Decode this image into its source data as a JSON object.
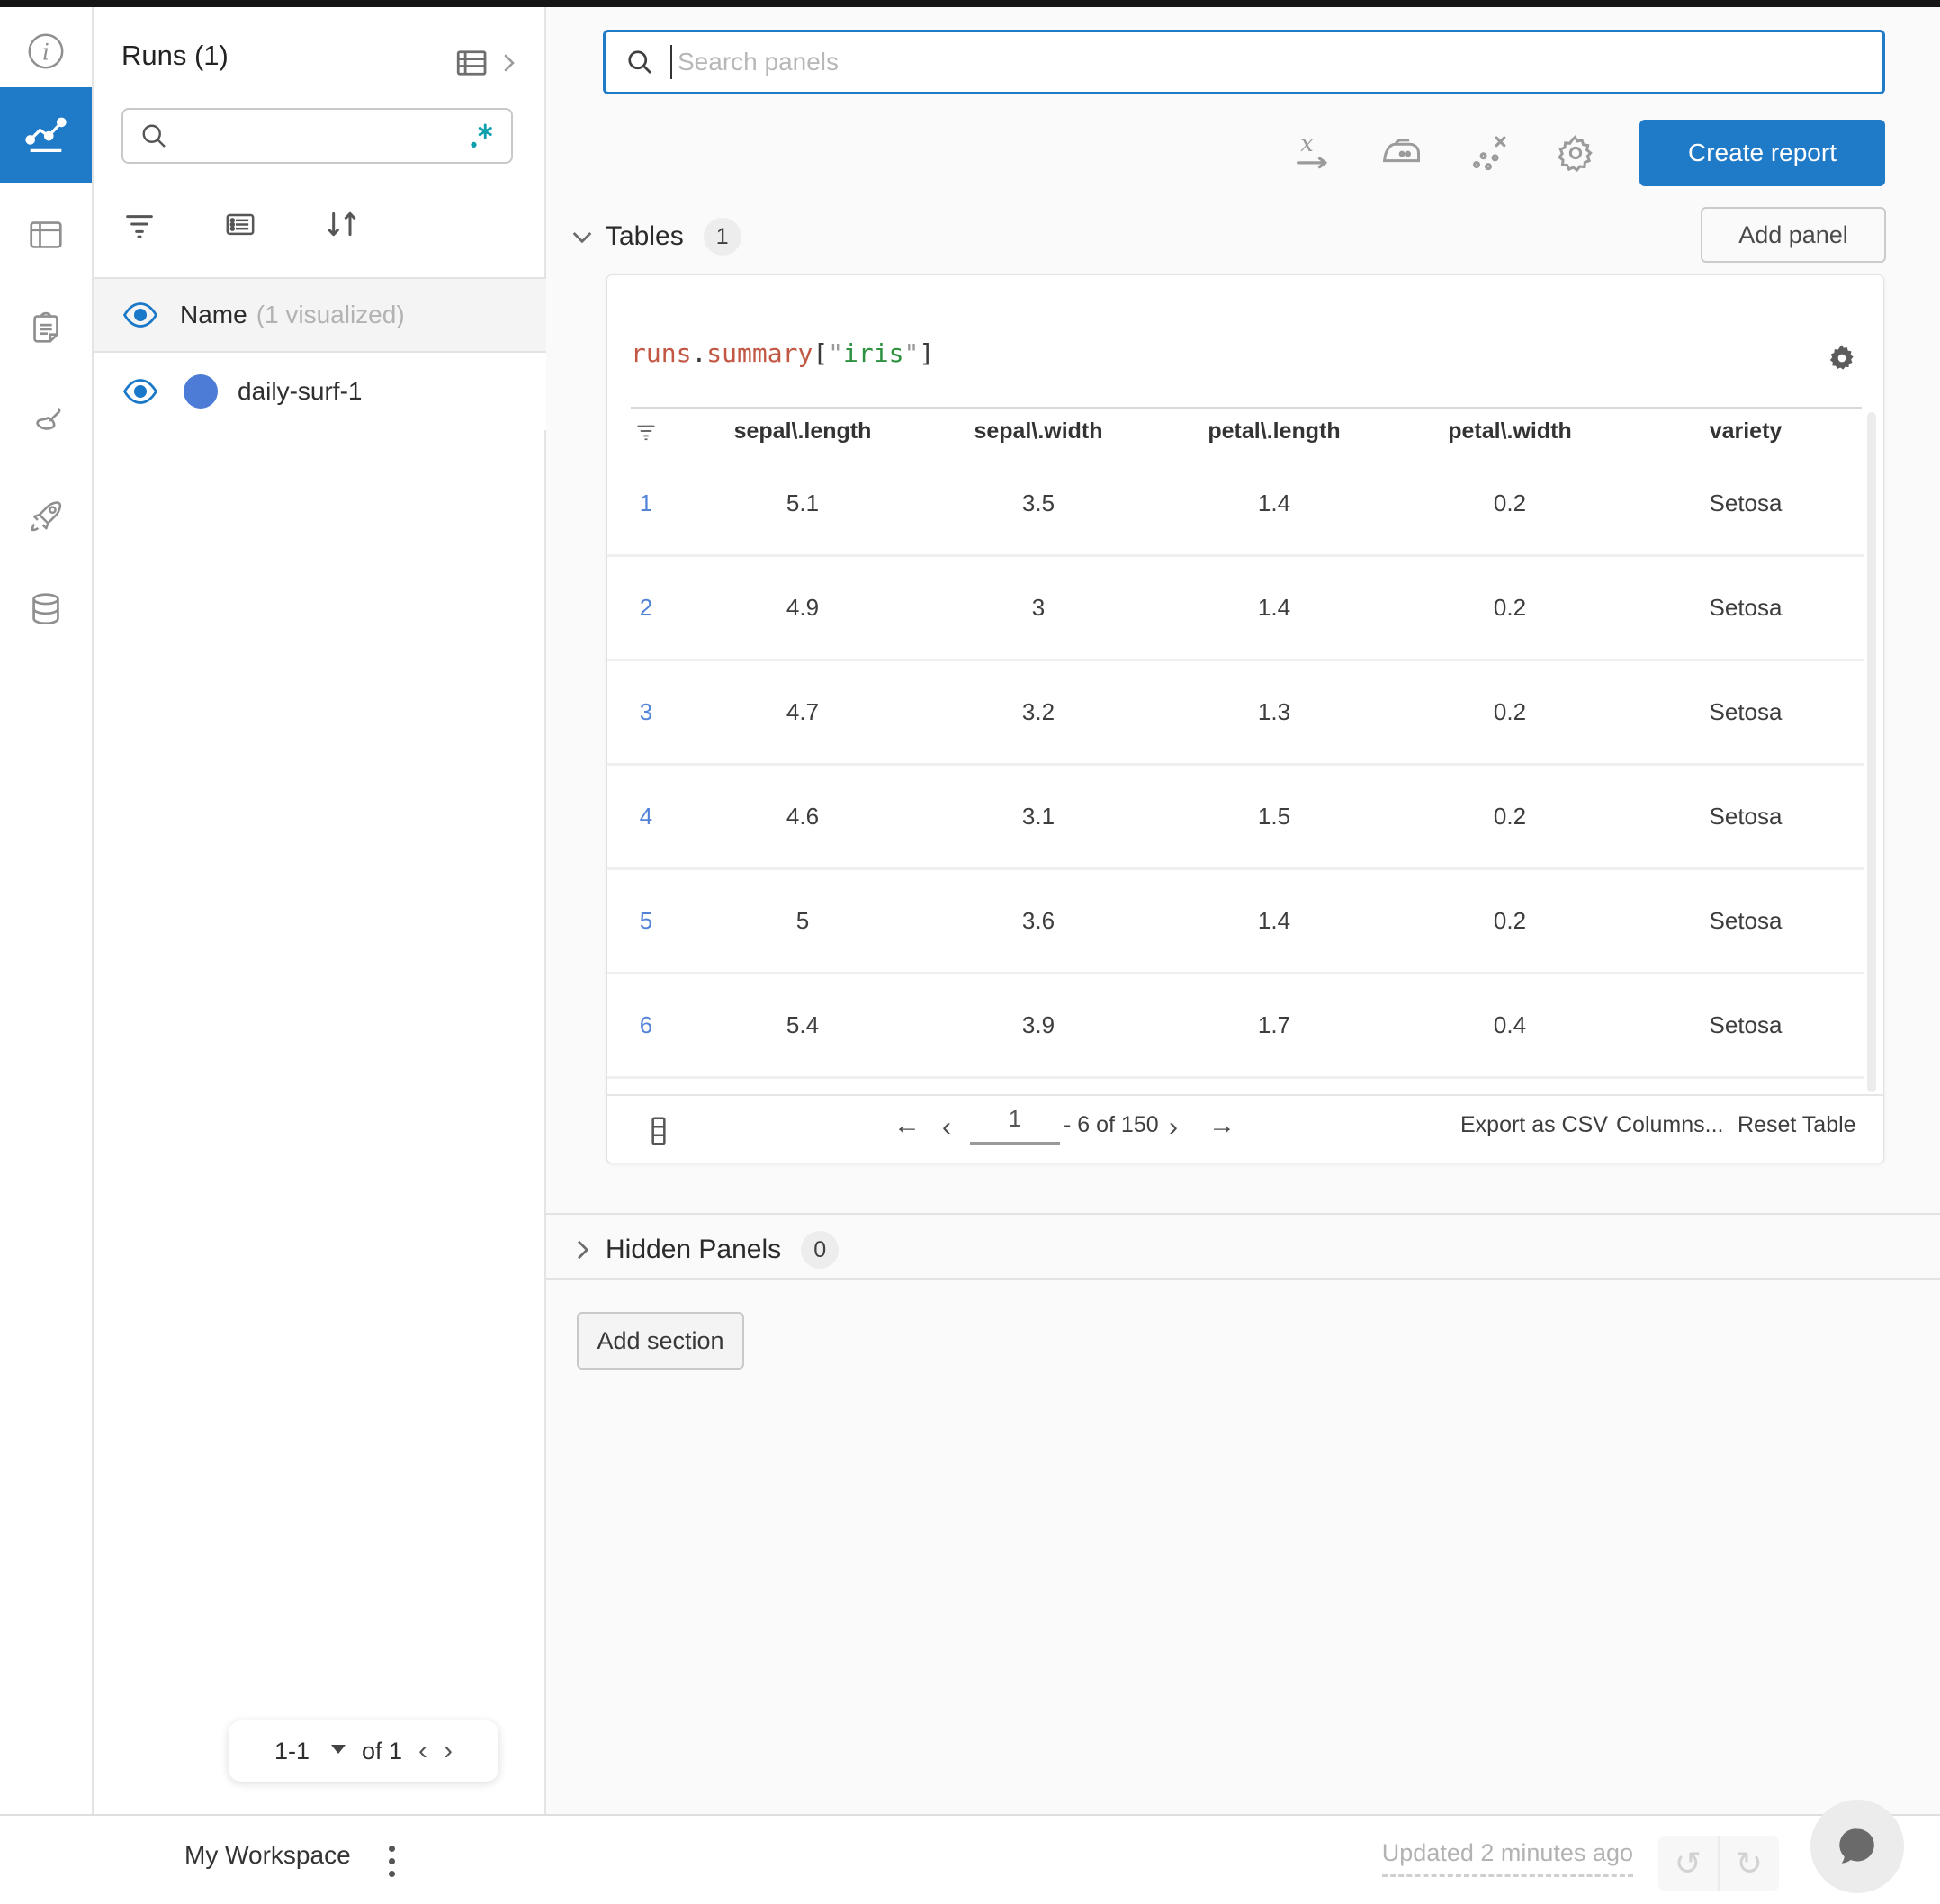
{
  "colors": {
    "accent": "#1f7ac8",
    "link-blue": "#5383d8",
    "run-dot": "#4d7cd6",
    "eye-blue": "#1a78c8",
    "teal": "#0e9fad",
    "code-orange": "#c25744",
    "code-green": "#2d9140"
  },
  "nav_rail": {
    "icons": [
      "info-icon",
      "line-chart-icon",
      "layout-icon",
      "clipboard-icon",
      "broom-icon",
      "rocket-icon",
      "database-icon"
    ]
  },
  "sidebar": {
    "title": "Runs (1)",
    "group": {
      "label": "Name",
      "suffix": "(1 visualized)"
    },
    "runs": [
      {
        "name": "daily-surf-1"
      }
    ],
    "pagination": {
      "range": "1-1",
      "of": "of 1",
      "prev": "‹",
      "next": "›"
    }
  },
  "topbar": {
    "search_placeholder": "Search panels",
    "create_report_label": "Create report",
    "quick_icons": [
      "x-axis-icon",
      "smoothing-iron-icon",
      "outliers-scatter-icon",
      "settings-gear-icon"
    ]
  },
  "sections": {
    "tables": {
      "label": "Tables",
      "count": "1",
      "add_panel_label": "Add panel"
    },
    "hidden": {
      "label": "Hidden Panels",
      "count": "0"
    },
    "add_section_label": "Add section"
  },
  "panel": {
    "title": {
      "obj": "runs",
      "dot1": ".",
      "method": "summary",
      "open": "[",
      "q1": "\"",
      "key": "iris",
      "q2": "\"",
      "close": "]"
    },
    "table": {
      "columns": [
        "sepal\\.length",
        "sepal\\.width",
        "petal\\.length",
        "petal\\.width",
        "variety"
      ],
      "rows": [
        {
          "index": "1",
          "values": [
            "5.1",
            "3.5",
            "1.4",
            "0.2",
            "Setosa"
          ]
        },
        {
          "index": "2",
          "values": [
            "4.9",
            "3",
            "1.4",
            "0.2",
            "Setosa"
          ]
        },
        {
          "index": "3",
          "values": [
            "4.7",
            "3.2",
            "1.3",
            "0.2",
            "Setosa"
          ]
        },
        {
          "index": "4",
          "values": [
            "4.6",
            "3.1",
            "1.5",
            "0.2",
            "Setosa"
          ]
        },
        {
          "index": "5",
          "values": [
            "5",
            "3.6",
            "1.4",
            "0.2",
            "Setosa"
          ]
        },
        {
          "index": "6",
          "values": [
            "5.4",
            "3.9",
            "1.7",
            "0.4",
            "Setosa"
          ]
        }
      ],
      "footer": {
        "page": "1",
        "range": "- 6 of 150",
        "first": "←",
        "prev": "‹",
        "next": "›",
        "last": "→",
        "export_label": "Export as CSV",
        "columns_label": "Columns...",
        "reset_label": "Reset Table"
      }
    }
  },
  "page_footer": {
    "workspace": "My Workspace",
    "updated": "Updated 2 minutes ago",
    "undo": "↺",
    "redo": "↻"
  }
}
